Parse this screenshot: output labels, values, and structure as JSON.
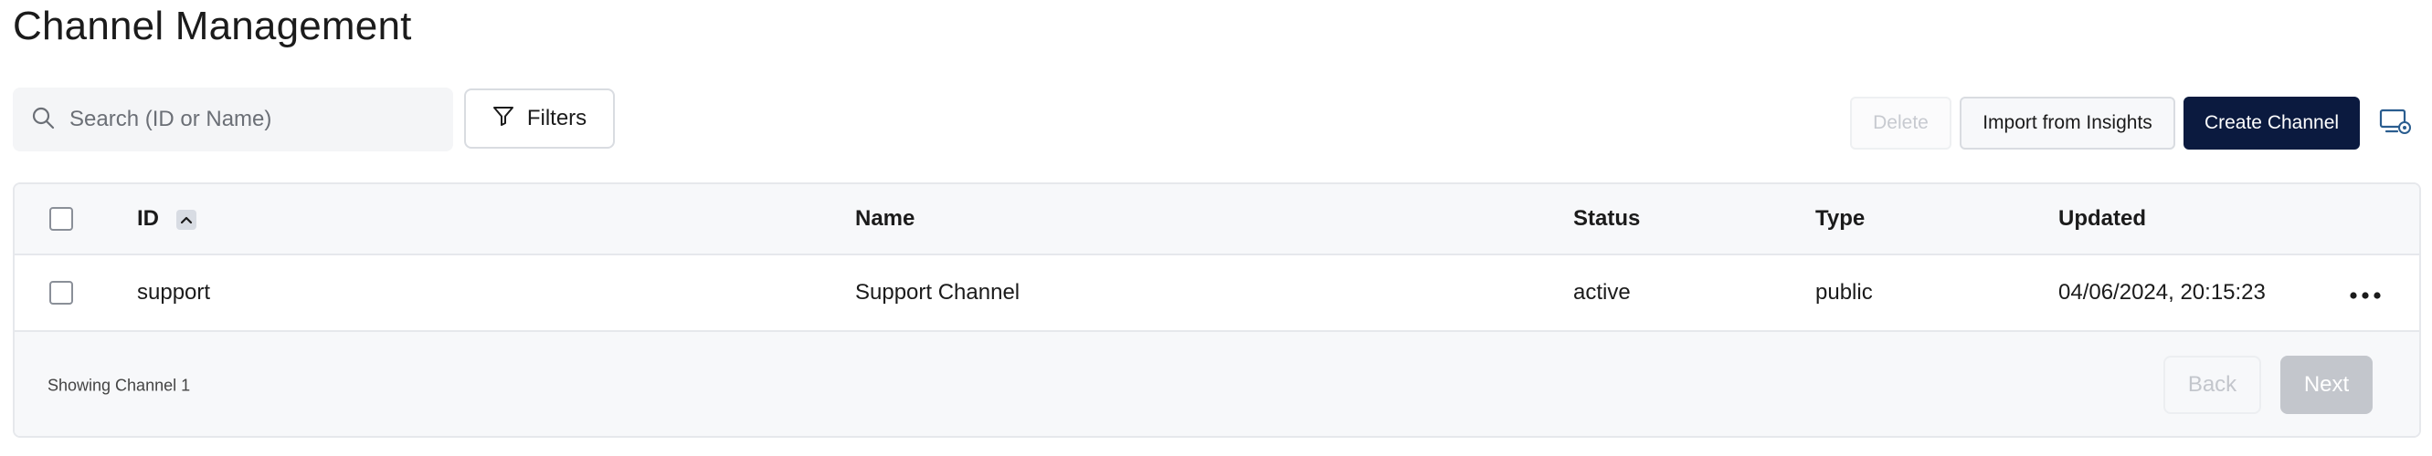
{
  "page": {
    "title": "Channel Management"
  },
  "toolbar": {
    "search_placeholder": "Search (ID or Name)",
    "filters_label": "Filters",
    "delete_label": "Delete",
    "import_label": "Import from Insights",
    "create_label": "Create Channel"
  },
  "table": {
    "columns": [
      "ID",
      "Name",
      "Status",
      "Type",
      "Updated"
    ],
    "rows": [
      {
        "id": "support",
        "name": "Support Channel",
        "status": "active",
        "type": "public",
        "updated": "04/06/2024, 20:15:23"
      }
    ],
    "sort": {
      "column": "ID",
      "direction": "ascending"
    }
  },
  "footer": {
    "showing_text": "Showing Channel 1",
    "back_label": "Back",
    "next_label": "Next"
  },
  "icons": {
    "search": "search-icon",
    "filter": "filter-icon",
    "sort": "chevron-up-icon",
    "more": "more-horizontal-icon",
    "settings": "screen-settings-icon"
  },
  "colors": {
    "primary": "#0b1a3f",
    "header_bg": "#f7f8fa",
    "border": "#e6e8ec",
    "disabled_text": "#c7cad0"
  }
}
